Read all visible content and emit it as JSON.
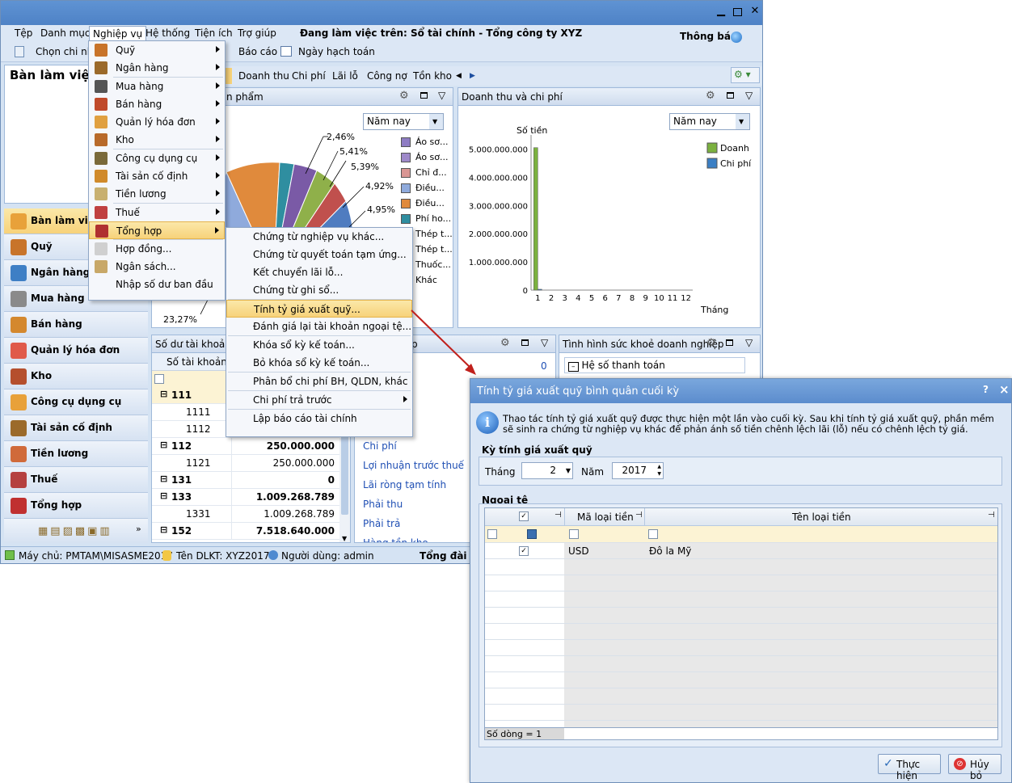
{
  "menubar": {
    "items": [
      "Tệp",
      "Danh mục",
      "Nghiệp vụ",
      "Hệ thống",
      "Tiện ích",
      "Trợ giúp"
    ],
    "working": "Đang làm việc trên: Sổ tài chính - Tổng công ty XYZ",
    "notify": "Thông báo"
  },
  "toolbar": {
    "chon": "Chọn chi nhá",
    "baocao": "Báo cáo",
    "ngay": "Ngày hạch toán"
  },
  "left": {
    "title": "Bàn làm việc",
    "nav": [
      "Bàn làm việc",
      "Quỹ",
      "Ngân hàng",
      "Mua hàng",
      "Bán hàng",
      "Quản lý hóa đơn",
      "Kho",
      "Công cụ dụng cụ",
      "Tài sản cố định",
      "Tiền lương",
      "Thuế",
      "Tổng hợp"
    ]
  },
  "tabs": [
    "Doanh thu",
    "Chi phí",
    "Lãi lỗ",
    "Công nợ",
    "Tồn kho"
  ],
  "pie": {
    "title": "n phẩm",
    "period": "Năm nay",
    "labels": [
      "2,46%",
      "5,41%",
      "5,39%",
      "4,92%",
      "4,95%",
      "23,27%"
    ],
    "legend": [
      "Áo sơ...",
      "Áo sơ...",
      "Chỉ đ...",
      "Điều...",
      "Điều...",
      "Phí ho...",
      "Thép t...",
      "Thép t...",
      "Thuốc...",
      "Khác"
    ]
  },
  "chart_data": {
    "type": "bar",
    "title": "Doanh thu và chi phí",
    "period": "Năm nay",
    "ylabel": "Số tiền",
    "xlabel": "Tháng",
    "categories": [
      "1",
      "2",
      "3",
      "4",
      "5",
      "6",
      "7",
      "8",
      "9",
      "10",
      "11",
      "12"
    ],
    "yticks": [
      "5.000.000.000",
      "4.000.000.000",
      "3.000.000.000",
      "2.000.000.000",
      "1.000.000.000",
      "0"
    ],
    "ylim": [
      0,
      5500000000
    ],
    "series": [
      {
        "name": "Doanh",
        "color": "#7bb13f",
        "values": [
          5050000000,
          0,
          0,
          0,
          0,
          0,
          0,
          0,
          0,
          0,
          0,
          0
        ]
      },
      {
        "name": "Chi phí",
        "color": "#3b7fc4",
        "values": [
          30000000,
          0,
          0,
          0,
          0,
          0,
          0,
          0,
          0,
          0,
          0,
          0
        ]
      }
    ]
  },
  "balance": {
    "title": "Số dư tài khoản",
    "col": "Số tài khoản",
    "rows": [
      [
        "111",
        ""
      ],
      [
        "1111",
        ""
      ],
      [
        "1112",
        ""
      ],
      [
        "112",
        "250.000.000"
      ],
      [
        "1121",
        "250.000.000"
      ],
      [
        "131",
        "0"
      ],
      [
        "133",
        "1.009.268.789"
      ],
      [
        "1331",
        "1.009.268.789"
      ],
      [
        "152",
        "7.518.640.000"
      ]
    ]
  },
  "mid": {
    "title": "p",
    "val": "0",
    "links": [
      "Chi phí",
      "Lợi nhuận trước thuế",
      "Lãi ròng tạm tính",
      "Phải thu",
      "Phải trả",
      "Hàng tồn kho"
    ]
  },
  "health": {
    "title": "Tình hình sức khoẻ doanh nghiệp",
    "item": "Hệ số thanh toán"
  },
  "nghiepvu_menu": [
    "Quỹ",
    "Ngân hàng",
    "Mua hàng",
    "Bán hàng",
    "Quản lý hóa đơn",
    "Kho",
    "Công cụ dụng cụ",
    "Tài sản cố định",
    "Tiền lương",
    "Thuế",
    "Tổng hợp",
    "Hợp đồng...",
    "Ngân sách...",
    "Nhập số dư ban đầu"
  ],
  "tonghop_menu": [
    "Chứng từ nghiệp vụ khác...",
    "Chứng từ quyết toán tạm ứng...",
    "Kết chuyển lãi lỗ...",
    "Chứng từ ghi sổ...",
    "Tính tỷ giá xuất quỹ...",
    "Đánh giá lại tài khoản ngoại tệ...",
    "Khóa sổ kỳ kế toán...",
    "Bỏ khóa sổ kỳ kế toán...",
    "Phân bổ chi phí BH, QLDN, khác",
    "Chi phí trả trước",
    "Lập báo cáo tài chính"
  ],
  "status": {
    "server": "Máy chủ: PMTAM\\MISASME2017",
    "db": "Tên DLKT: XYZ2017",
    "user": "Người dùng: admin",
    "hotline": "Tổng đài tư"
  },
  "dialog": {
    "title": "Tính tỷ giá xuất quỹ bình quân cuối kỳ",
    "help": "?",
    "close": "×",
    "info": "Thao tác tính tỷ giá xuất quỹ được thực hiện một lần vào cuối kỳ. Sau khi tính tỷ giá xuất quỹ, phần mềm sẽ sinh ra chứng từ nghiệp vụ khác để phản ánh số tiền chênh lệch lãi (lỗ) nếu có chênh lệch tỷ giá.",
    "period_group": "Kỳ tính giá xuất quỹ",
    "month_label": "Tháng",
    "month": "2",
    "year_label": "Năm",
    "year": "2017",
    "fx_group": "Ngoại tệ",
    "col_code": "Mã loại tiền",
    "col_name": "Tên loại tiền",
    "rows": [
      [
        "USD",
        "Đô la Mỹ"
      ]
    ],
    "count": "Số dòng = 1",
    "ok": "Thực hiện",
    "cancel": "Hủy bỏ"
  }
}
